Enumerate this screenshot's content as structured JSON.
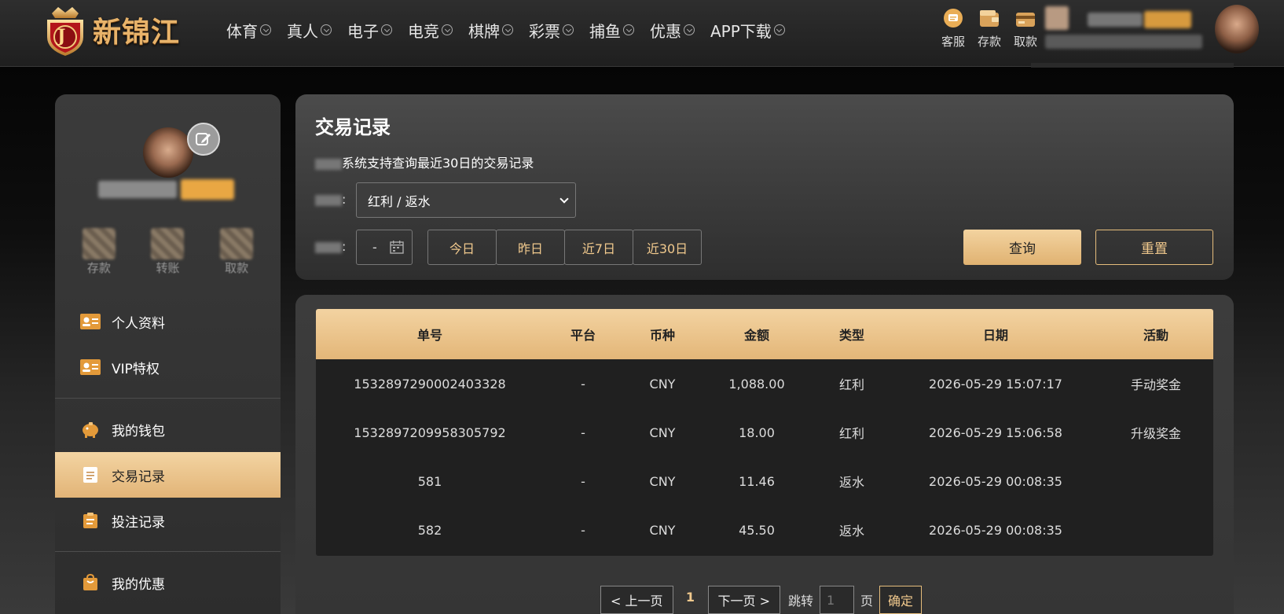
{
  "brand": {
    "name": "新锦江",
    "badge_letter": "J",
    "accent": "#e6b877"
  },
  "nav": [
    {
      "label": "体育"
    },
    {
      "label": "真人"
    },
    {
      "label": "电子"
    },
    {
      "label": "电竞"
    },
    {
      "label": "棋牌"
    },
    {
      "label": "彩票"
    },
    {
      "label": "捕鱼"
    },
    {
      "label": "优惠"
    },
    {
      "label": "APP下载"
    }
  ],
  "quick_links": [
    {
      "label": "客服",
      "icon": "chat-bubble-icon"
    },
    {
      "label": "存款",
      "icon": "wallet-icon"
    },
    {
      "label": "取款",
      "icon": "atm-card-icon"
    }
  ],
  "sidebar": {
    "actions": [
      {
        "label": "存款",
        "icon": "deposit-icon"
      },
      {
        "label": "转账",
        "icon": "transfer-icon"
      },
      {
        "label": "取款",
        "icon": "withdraw-icon"
      }
    ],
    "menu_group1": [
      {
        "label": "个人资料",
        "icon": "id-card-icon"
      },
      {
        "label": "VIP特权",
        "icon": "vip-card-icon"
      }
    ],
    "menu_group2": [
      {
        "label": "我的钱包",
        "icon": "piggy-bank-icon"
      },
      {
        "label": "交易记录",
        "icon": "document-icon",
        "active": true
      },
      {
        "label": "投注记录",
        "icon": "clipboard-icon"
      }
    ],
    "menu_group3": [
      {
        "label": "我的优惠",
        "icon": "gift-bag-icon"
      }
    ]
  },
  "filter": {
    "title": "交易记录",
    "note": "系统支持查询最近30日的交易记录",
    "type_value": "红利 / 返水",
    "date_value": "-",
    "quick_ranges": [
      "今日",
      "昨日",
      "近7日",
      "近30日"
    ],
    "query_label": "查询",
    "reset_label": "重置"
  },
  "table": {
    "headers": [
      "单号",
      "平台",
      "币种",
      "金额",
      "类型",
      "日期",
      "活動"
    ],
    "rows": [
      [
        "1532897290002403328",
        "-",
        "CNY",
        "1,088.00",
        "红利",
        "2026-05-29 15:07:17",
        "手动奖金"
      ],
      [
        "1532897209958305792",
        "-",
        "CNY",
        "18.00",
        "红利",
        "2026-05-29 15:06:58",
        "升级奖金"
      ],
      [
        "581",
        "-",
        "CNY",
        "11.46",
        "返水",
        "2026-05-29 00:08:35",
        ""
      ],
      [
        "582",
        "-",
        "CNY",
        "45.50",
        "返水",
        "2026-05-29 00:08:35",
        ""
      ]
    ]
  },
  "pagination": {
    "prev_label": "< 上一页",
    "current_page": "1",
    "next_label": "下一页 >",
    "jump_label": "跳转",
    "jump_placeholder": "1",
    "page_unit": "页",
    "confirm_label": "确定"
  }
}
